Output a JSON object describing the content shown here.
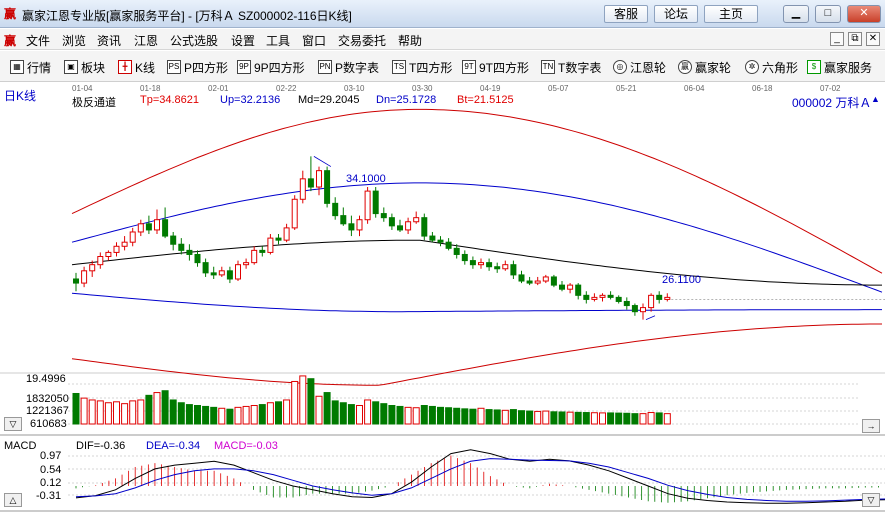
{
  "window": {
    "title": "赢家江恩专业版[赢家服务平台] - [万科Ａ  SZ000002-116日K线]",
    "app_icon": "赢",
    "links": [
      "客服",
      "论坛",
      "主页"
    ],
    "controls": {
      "minimize": "▁",
      "maximize": "□",
      "close": "✕"
    }
  },
  "menu": {
    "logo": "赢",
    "items": [
      "文件",
      "浏览",
      "资讯",
      "江恩",
      "公式选股",
      "设置",
      "工具",
      "窗口",
      "交易委托",
      "帮助"
    ],
    "controls": [
      "_",
      "⧉",
      "✕"
    ]
  },
  "toolbar": [
    {
      "label": "行情",
      "icon": "grid-icon",
      "glyph": "▦"
    },
    {
      "label": "板块",
      "icon": "blocks-icon",
      "glyph": "▣"
    },
    {
      "label": "K线",
      "icon": "candlestick-icon",
      "glyph": "╋"
    },
    {
      "label": "P四方形",
      "icon": "ps-icon",
      "glyph": "PS"
    },
    {
      "label": "9P四方形",
      "icon": "9p-icon",
      "glyph": "9P"
    },
    {
      "label": "P数字表",
      "icon": "pn-icon",
      "glyph": "PN"
    },
    {
      "label": "T四方形",
      "icon": "ts-icon",
      "glyph": "TS"
    },
    {
      "label": "9T四方形",
      "icon": "9t-icon",
      "glyph": "9T"
    },
    {
      "label": "T数字表",
      "icon": "tn-icon",
      "glyph": "TN"
    },
    {
      "label": "江恩轮",
      "icon": "gann-wheel-icon",
      "glyph": "◎"
    },
    {
      "label": "赢家轮",
      "icon": "winner-wheel-icon",
      "glyph": "赢"
    },
    {
      "label": "六角形",
      "icon": "hexagon-icon",
      "glyph": "✲"
    },
    {
      "label": "赢家服务",
      "icon": "dollar-icon",
      "glyph": "$"
    }
  ],
  "chart_header": {
    "period": "日K线",
    "dates": [
      "01-04",
      "01-18",
      "02-01",
      "02-22",
      "03-10",
      "03-30",
      "04-19",
      "05-07",
      "05-21",
      "06-04",
      "06-18",
      "07-02"
    ],
    "indicator": "极反通道",
    "tp": "Tp=34.8621",
    "up": "Up=32.2136",
    "md": "Md=29.2045",
    "dn": "Dn=25.1728",
    "bt": "Bt=21.5125",
    "stock": "000002  万科Ａ",
    "high_label": "34.1000",
    "low_label": "26.1100",
    "arrow": "▲"
  },
  "volume_panel": {
    "axis": [
      "19.4996",
      "1832050",
      "1221367",
      "610683"
    ]
  },
  "macd_panel": {
    "name": "MACD",
    "dif": "DIF=-0.36",
    "dea": "DEA=-0.34",
    "macd": "MACD=-0.03",
    "axis": [
      "0.97",
      "0.54",
      "0.12",
      "-0.31"
    ]
  },
  "colors": {
    "up": "#e00000",
    "down": "#007a00",
    "channel_outer": "#cc0000",
    "channel_inner": "#0000cc",
    "mid": "#000000",
    "grid": "#b0b0b0"
  },
  "chart_data": [
    {
      "type": "candlestick",
      "title": "万科Ａ 日K线 极反通道",
      "series": [
        {
          "name": "万科Ａ",
          "ohlc": [
            [
              28.1,
              27.9,
              28.4,
              27.5
            ],
            [
              27.9,
              28.5,
              28.7,
              27.7
            ],
            [
              28.5,
              28.8,
              29.0,
              28.2
            ],
            [
              28.8,
              29.2,
              29.4,
              28.6
            ],
            [
              29.2,
              29.4,
              29.5,
              29.0
            ],
            [
              29.4,
              29.7,
              29.9,
              29.2
            ],
            [
              29.7,
              29.9,
              30.2,
              29.5
            ],
            [
              29.9,
              30.4,
              30.6,
              29.7
            ],
            [
              30.4,
              30.8,
              31.0,
              30.2
            ],
            [
              30.8,
              30.5,
              31.2,
              30.3
            ],
            [
              30.5,
              31.0,
              31.5,
              30.3
            ],
            [
              31.0,
              30.2,
              31.6,
              30.1
            ],
            [
              30.2,
              29.8,
              30.4,
              29.5
            ],
            [
              29.8,
              29.5,
              30.1,
              29.3
            ],
            [
              29.5,
              29.3,
              29.8,
              29.0
            ],
            [
              29.3,
              28.9,
              29.5,
              28.7
            ],
            [
              28.9,
              28.4,
              29.1,
              28.2
            ],
            [
              28.4,
              28.3,
              28.7,
              28.1
            ],
            [
              28.3,
              28.5,
              28.7,
              28.2
            ],
            [
              28.5,
              28.1,
              28.7,
              27.9
            ],
            [
              28.1,
              28.8,
              29.0,
              28.0
            ],
            [
              28.8,
              28.9,
              29.1,
              28.6
            ],
            [
              28.9,
              29.5,
              29.7,
              28.8
            ],
            [
              29.5,
              29.4,
              29.7,
              29.2
            ],
            [
              29.4,
              30.1,
              30.3,
              29.3
            ],
            [
              30.1,
              30.0,
              30.3,
              29.8
            ],
            [
              30.0,
              30.6,
              30.8,
              29.9
            ],
            [
              30.6,
              32.0,
              32.2,
              30.5
            ],
            [
              32.0,
              33.0,
              33.4,
              31.8
            ],
            [
              33.0,
              32.6,
              34.1,
              32.4
            ],
            [
              32.6,
              33.4,
              33.6,
              32.2
            ],
            [
              33.4,
              31.8,
              33.6,
              31.6
            ],
            [
              31.8,
              31.2,
              32.1,
              31.0
            ],
            [
              31.2,
              30.8,
              31.6,
              30.7
            ],
            [
              30.8,
              30.5,
              31.2,
              30.2
            ],
            [
              30.5,
              31.0,
              31.2,
              30.2
            ],
            [
              31.0,
              32.4,
              32.6,
              30.8
            ],
            [
              32.4,
              31.3,
              32.6,
              31.1
            ],
            [
              31.3,
              31.1,
              31.6,
              30.9
            ],
            [
              31.1,
              30.7,
              31.3,
              30.5
            ],
            [
              30.7,
              30.5,
              31.0,
              30.4
            ],
            [
              30.5,
              30.9,
              31.1,
              30.3
            ],
            [
              30.9,
              31.1,
              31.4,
              30.8
            ],
            [
              31.1,
              30.2,
              31.3,
              30.0
            ],
            [
              30.2,
              30.0,
              30.4,
              29.9
            ],
            [
              30.0,
              29.9,
              30.2,
              29.7
            ],
            [
              29.9,
              29.6,
              30.1,
              29.5
            ],
            [
              29.6,
              29.3,
              29.8,
              29.1
            ],
            [
              29.3,
              29.0,
              29.5,
              28.8
            ],
            [
              29.0,
              28.8,
              29.2,
              28.6
            ],
            [
              28.8,
              28.9,
              29.1,
              28.6
            ],
            [
              28.9,
              28.7,
              29.1,
              28.5
            ],
            [
              28.7,
              28.6,
              28.9,
              28.4
            ],
            [
              28.6,
              28.8,
              29.0,
              28.5
            ],
            [
              28.8,
              28.3,
              29.0,
              28.1
            ],
            [
              28.3,
              28.0,
              28.5,
              27.9
            ],
            [
              28.0,
              27.9,
              28.2,
              27.8
            ],
            [
              27.9,
              28.0,
              28.2,
              27.8
            ],
            [
              28.0,
              28.2,
              28.3,
              27.9
            ],
            [
              28.2,
              27.8,
              28.3,
              27.7
            ],
            [
              27.8,
              27.6,
              28.0,
              27.5
            ],
            [
              27.6,
              27.8,
              27.9,
              27.4
            ],
            [
              27.8,
              27.3,
              27.9,
              27.1
            ],
            [
              27.3,
              27.1,
              27.5,
              26.9
            ],
            [
              27.1,
              27.2,
              27.4,
              27.0
            ],
            [
              27.2,
              27.3,
              27.4,
              27.0
            ],
            [
              27.3,
              27.2,
              27.5,
              27.1
            ],
            [
              27.2,
              27.0,
              27.3,
              26.9
            ],
            [
              27.0,
              26.8,
              27.2,
              26.6
            ],
            [
              26.8,
              26.5,
              26.9,
              26.3
            ],
            [
              26.5,
              26.7,
              26.9,
              26.11
            ],
            [
              26.7,
              27.3,
              27.4,
              26.5
            ],
            [
              27.3,
              27.1,
              27.5,
              26.9
            ],
            [
              27.1,
              27.2,
              27.4,
              27.0
            ]
          ],
          "volume": [
            1650000,
            1400000,
            1300000,
            1250000,
            1150000,
            1200000,
            1100000,
            1250000,
            1300000,
            1550000,
            1700000,
            1800000,
            1300000,
            1150000,
            1050000,
            1000000,
            950000,
            900000,
            850000,
            800000,
            900000,
            950000,
            1000000,
            1050000,
            1150000,
            1200000,
            1300000,
            2300000,
            2600000,
            2450000,
            1500000,
            1700000,
            1250000,
            1150000,
            1050000,
            1000000,
            1300000,
            1200000,
            1100000,
            1000000,
            950000,
            900000,
            880000,
            1000000,
            950000,
            900000,
            880000,
            850000,
            820000,
            800000,
            850000,
            780000,
            760000,
            740000,
            780000,
            720000,
            700000,
            680000,
            700000,
            660000,
            650000,
            640000,
            630000,
            620000,
            610000,
            600000,
            600000,
            590000,
            580000,
            560000,
            560000,
            620000,
            600000,
            560000
          ]
        }
      ],
      "channels": {
        "tp_start": 31.3,
        "tp_peak": 36.4,
        "up_start": 29.9,
        "up_peak": 32.8,
        "md_start": 28.8,
        "md_end": 27.8,
        "dn_start": 27.4,
        "dn_end": 26.6,
        "bt_start": 24.2,
        "bt_end": 25.9
      },
      "ylim": [
        23.5,
        37.2
      ]
    },
    {
      "type": "line",
      "title": "MACD",
      "series": [
        {
          "name": "DIF",
          "values": [
            -0.31,
            -0.25,
            -0.1,
            0.2,
            0.45,
            0.55,
            0.6,
            0.65,
            0.55,
            0.35,
            0.15,
            0.0,
            -0.1,
            -0.2,
            -0.28,
            -0.3,
            -0.2,
            0.1,
            0.5,
            0.85,
            0.95,
            0.85,
            0.7,
            0.65,
            0.7,
            0.66,
            0.55,
            0.4,
            0.2,
            0.0,
            -0.2,
            -0.32,
            -0.38,
            -0.42,
            -0.44,
            -0.45,
            -0.45,
            -0.44,
            -0.42,
            -0.4,
            -0.37,
            -0.36
          ]
        },
        {
          "name": "DEA",
          "values": [
            -0.28,
            -0.26,
            -0.2,
            -0.05,
            0.15,
            0.3,
            0.4,
            0.45,
            0.45,
            0.4,
            0.3,
            0.15,
            0.0,
            -0.1,
            -0.18,
            -0.24,
            -0.2,
            -0.05,
            0.2,
            0.45,
            0.65,
            0.72,
            0.7,
            0.68,
            0.67,
            0.66,
            0.6,
            0.5,
            0.35,
            0.2,
            0.02,
            -0.12,
            -0.22,
            -0.3,
            -0.35,
            -0.38,
            -0.4,
            -0.4,
            -0.39,
            -0.37,
            -0.35,
            -0.34
          ]
        }
      ],
      "ylim": [
        -0.55,
        1.05
      ]
    }
  ]
}
